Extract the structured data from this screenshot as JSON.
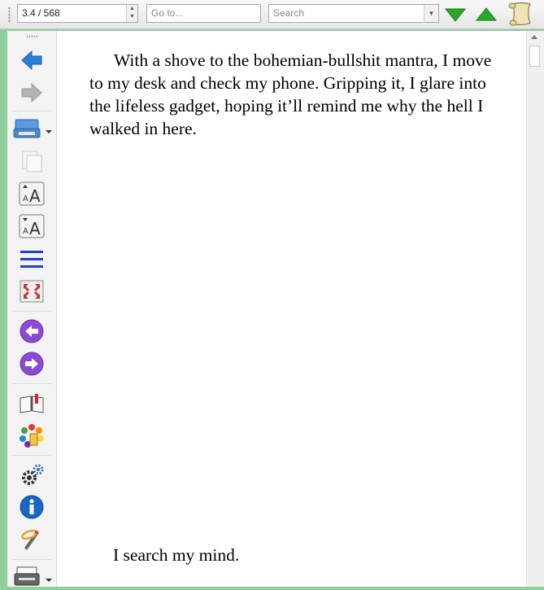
{
  "toolbar": {
    "page_indicator": "3.4 / 568",
    "goto_placeholder": "Go to...",
    "search_placeholder": "Search"
  },
  "sidebar": {
    "icons": [
      "back-icon",
      "forward-icon",
      "print-icon",
      "copy-icon",
      "font-increase-icon",
      "font-decrease-icon",
      "line-spacing-icon",
      "fullscreen-icon",
      "previous-chapter-icon",
      "next-chapter-icon",
      "bookmark-icon",
      "color-theme-icon",
      "settings-icon",
      "info-icon",
      "tools-icon",
      "print-icon"
    ]
  },
  "document": {
    "paragraph1": "With a shove to the bohemian-bullshit mantra, I move to my desk and check my phone. Gripping it, I glare into the lifeless gadget, hoping it’ll remind me why the hell I walked in here.",
    "paragraph2": "I search my mind."
  },
  "colors": {
    "background": "#8fcf9f",
    "accent_green": "#1ea31e",
    "back_blue": "#2b7fd8",
    "chapter_purple": "#8c4ad2"
  }
}
